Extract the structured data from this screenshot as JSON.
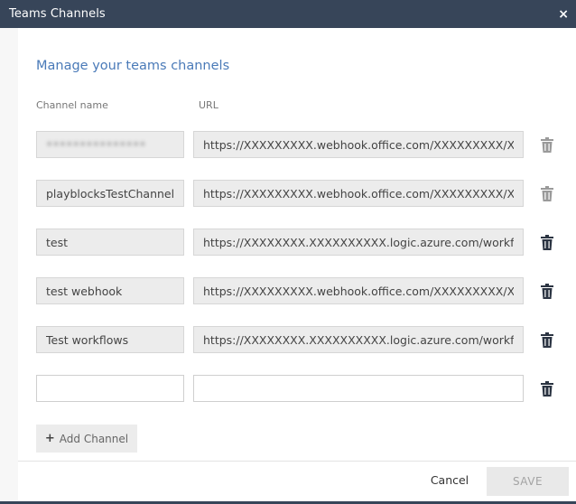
{
  "dialog": {
    "title": "Teams Channels",
    "close_glyph": "×"
  },
  "content": {
    "heading": "Manage your teams channels",
    "columns": {
      "name": "Channel name",
      "url": "URL"
    }
  },
  "channels": [
    {
      "name": "•••••••••••••••",
      "name_obscured": true,
      "url": "https://XXXXXXXXX.webhook.office.com/XXXXXXXXX/XXXXX",
      "delete_enabled": false
    },
    {
      "name": "playblocksTestChannelForDemo",
      "name_obscured": false,
      "url": "https://XXXXXXXXX.webhook.office.com/XXXXXXXXX/XXXXX",
      "delete_enabled": false
    },
    {
      "name": "test",
      "name_obscured": false,
      "url": "https://XXXXXXXX.XXXXXXXXXX.logic.azure.com/workflows/",
      "delete_enabled": true
    },
    {
      "name": "test webhook",
      "name_obscured": false,
      "url": "https://XXXXXXXXX.webhook.office.com/XXXXXXXXX/XXXXX",
      "delete_enabled": true
    },
    {
      "name": "Test workflows",
      "name_obscured": false,
      "url": "https://XXXXXXXX.XXXXXXXXXX.logic.azure.com/workflows/",
      "delete_enabled": true
    }
  ],
  "new_channel": {
    "name": "",
    "url": ""
  },
  "buttons": {
    "add_channel": "Add Channel",
    "add_icon": "plus-icon",
    "cancel": "Cancel",
    "save": "SAVE"
  },
  "icons": {
    "delete": "trash-icon",
    "close": "close-icon"
  },
  "colors": {
    "titlebar": "#374559",
    "heading": "#4a7ab8",
    "trash_enabled": "#2b3442",
    "trash_disabled": "#9a9a9a"
  }
}
